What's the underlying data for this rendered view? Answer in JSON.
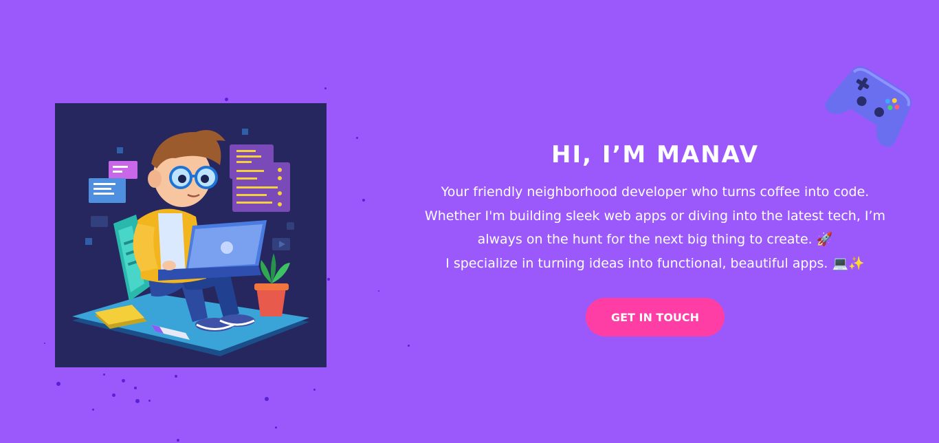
{
  "hero": {
    "title": "HI, I’M MANAV",
    "bio_lines": [
      "Your friendly neighborhood developer who turns coffee into code.",
      "Whether I'm building sleek web apps or diving into the latest tech, I’m",
      "always on the hunt for the next big thing to create. 🚀",
      "I specialize in turning ideas into functional, beautiful apps. 💻✨"
    ],
    "cta_label": "GET IN TOUCH"
  },
  "illustration": {
    "subject": "developer-with-laptop-illustration"
  },
  "decor": {
    "icon": "gamepad-icon"
  },
  "colors": {
    "background": "#9b59fc",
    "illustration_bg": "#272760",
    "accent_button": "#ff3ea5",
    "text": "#ffffff"
  }
}
